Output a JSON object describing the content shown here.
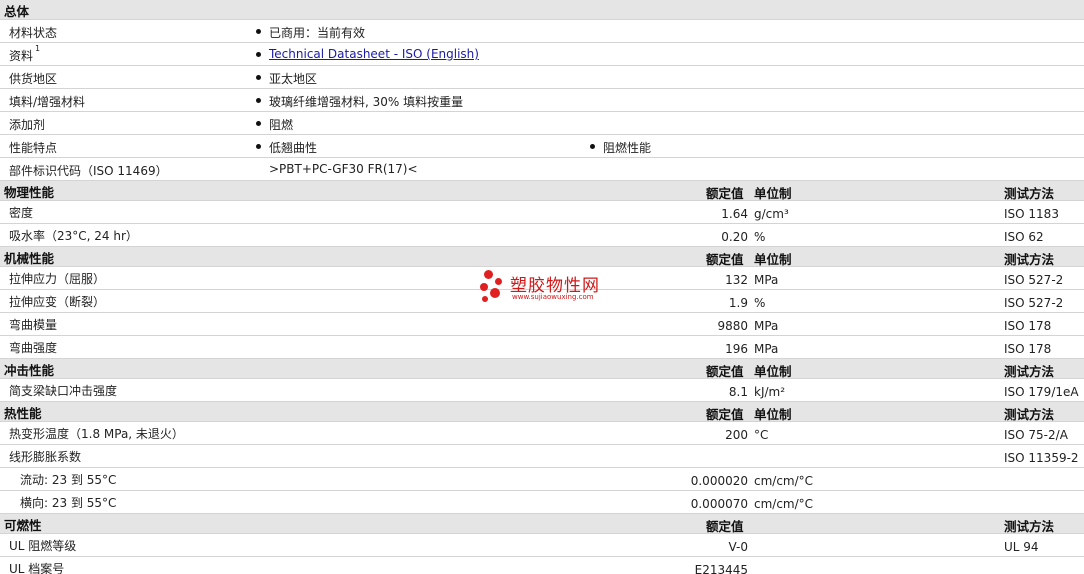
{
  "general": {
    "title": "总体",
    "rows": [
      {
        "label": "材料状态",
        "values": [
          "已商用：当前有效"
        ]
      },
      {
        "label": "资料",
        "sup": "1",
        "link": "Technical Datasheet - ISO (English)"
      },
      {
        "label": "供货地区",
        "values": [
          "亚太地区"
        ]
      },
      {
        "label": "填料/增强材料",
        "values": [
          "玻璃纤维增强材料, 30% 填料按重量"
        ]
      },
      {
        "label": "添加剂",
        "values": [
          "阻燃"
        ]
      },
      {
        "label": "性能特点",
        "values": [
          "低翘曲性",
          "阻燃性能"
        ]
      },
      {
        "label": "部件标识代码（ISO 11469）",
        "plain": ">PBT+PC-GF30 FR(17)<"
      }
    ]
  },
  "columns": {
    "rated": "额定值",
    "unit": "单位制",
    "method": "测试方法"
  },
  "sections": [
    {
      "title": "物理性能",
      "show_unit_header": true,
      "rows": [
        {
          "label": "密度",
          "value": "1.64",
          "unit": "g/cm³",
          "method": "ISO 1183"
        },
        {
          "label": "吸水率（23°C, 24 hr）",
          "value": "0.20",
          "unit": "%",
          "method": "ISO 62"
        }
      ]
    },
    {
      "title": "机械性能",
      "show_unit_header": true,
      "rows": [
        {
          "label": "拉伸应力（屈服）",
          "value": "132",
          "unit": "MPa",
          "method": "ISO 527-2"
        },
        {
          "label": "拉伸应变（断裂）",
          "value": "1.9",
          "unit": "%",
          "method": "ISO 527-2"
        },
        {
          "label": "弯曲模量",
          "value": "9880",
          "unit": "MPa",
          "method": "ISO 178"
        },
        {
          "label": "弯曲强度",
          "value": "196",
          "unit": "MPa",
          "method": "ISO 178"
        }
      ]
    },
    {
      "title": "冲击性能",
      "show_unit_header": true,
      "rows": [
        {
          "label": "简支梁缺口冲击强度",
          "value": "8.1",
          "unit": "kJ/m²",
          "method": "ISO 179/1eA"
        }
      ]
    },
    {
      "title": "热性能",
      "show_unit_header": true,
      "rows": [
        {
          "label": "热变形温度（1.8 MPa, 未退火）",
          "value": "200",
          "unit": "°C",
          "method": "ISO 75-2/A"
        },
        {
          "label": "线形膨胀系数",
          "value": "",
          "unit": "",
          "method": "ISO 11359-2"
        },
        {
          "label": "流动: 23 到  55°C",
          "indent": true,
          "value": "0.000020",
          "unit": "cm/cm/°C",
          "method": ""
        },
        {
          "label": "横向: 23 到  55°C",
          "indent": true,
          "value": "0.000070",
          "unit": "cm/cm/°C",
          "method": ""
        }
      ]
    },
    {
      "title": "可燃性",
      "show_unit_header": false,
      "rows": [
        {
          "label": "UL 阻燃等级",
          "value": "V-0",
          "unit": "",
          "method": "UL 94"
        },
        {
          "label": "UL 档案号",
          "value": "E213445",
          "unit": "",
          "method": ""
        }
      ]
    }
  ],
  "watermark": {
    "name": "塑胶物性网",
    "url": "www.sujiaowuxing.com",
    "color": "#d01818"
  }
}
